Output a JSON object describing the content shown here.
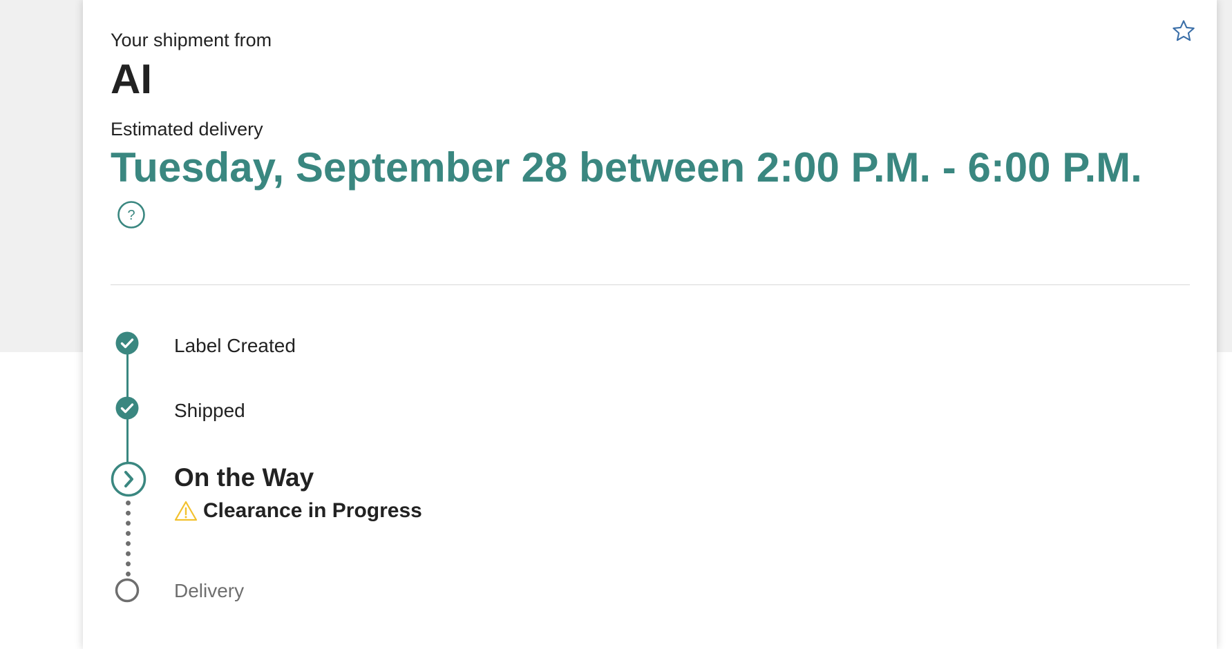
{
  "shipment": {
    "from_label": "Your shipment from",
    "sender": "AI",
    "estimated_label": "Estimated delivery",
    "estimated_delivery": "Tuesday, September 28 between 2:00 P.M. - 6:00 P.M."
  },
  "icons": {
    "favorite": "star-outline-icon",
    "help": "question-circle-icon",
    "done": "check-circle-icon",
    "current": "chevron-right-circle-icon",
    "pending": "empty-circle-icon",
    "warning": "warning-triangle-icon"
  },
  "timeline": {
    "steps": [
      {
        "label": "Label Created",
        "status": "complete"
      },
      {
        "label": "Shipped",
        "status": "complete"
      },
      {
        "label": "On the Way",
        "status": "current",
        "sub_status": "Clearance in Progress"
      },
      {
        "label": "Delivery",
        "status": "pending"
      }
    ]
  },
  "colors": {
    "accent": "#3a8780",
    "text": "#222222",
    "muted": "#6e6e6e",
    "warning": "#f2c12e",
    "star": "#3b6fa8",
    "page_bg": "#f0f0f0"
  }
}
